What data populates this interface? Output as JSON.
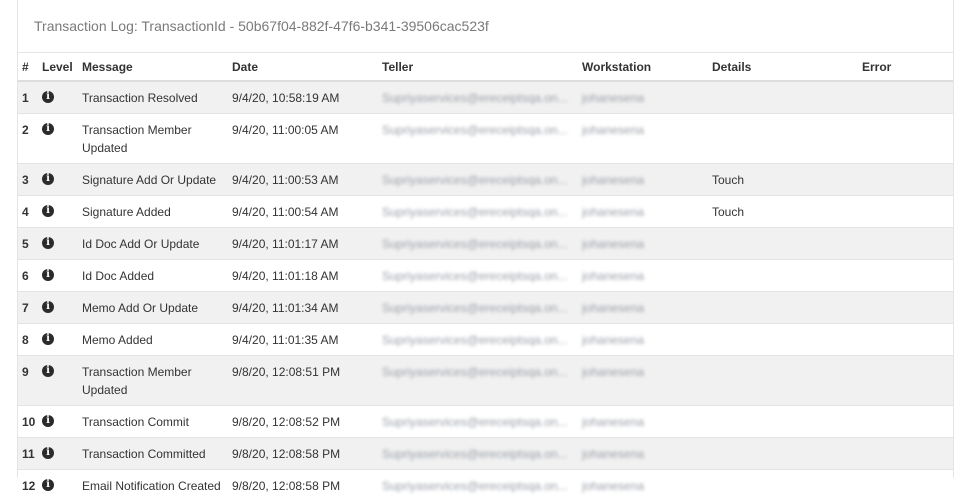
{
  "panel": {
    "title": "Transaction Log: TransactionId - 50b67f04-882f-47f6-b341-39506cac523f"
  },
  "table": {
    "headers": {
      "num": "#",
      "level": "Level",
      "message": "Message",
      "date": "Date",
      "teller": "Teller",
      "workstation": "Workstation",
      "details": "Details",
      "error": "Error"
    },
    "rows": [
      {
        "num": "1",
        "level_icon": "info-icon",
        "message": "Transaction Resolved",
        "date": "9/4/20, 10:58:19 AM",
        "teller": "Supriyaservices@ereceiptsqa.on...",
        "workstation": "johanesena",
        "details": "",
        "error": ""
      },
      {
        "num": "2",
        "level_icon": "info-icon",
        "message": "Transaction Member Updated",
        "date": "9/4/20, 11:00:05 AM",
        "teller": "Supriyaservices@ereceiptsqa.on...",
        "workstation": "johanesena",
        "details": "",
        "error": ""
      },
      {
        "num": "3",
        "level_icon": "info-icon",
        "message": "Signature Add Or Update",
        "date": "9/4/20, 11:00:53 AM",
        "teller": "Supriyaservices@ereceiptsqa.on...",
        "workstation": "johanesena",
        "details": "Touch",
        "error": ""
      },
      {
        "num": "4",
        "level_icon": "info-icon",
        "message": "Signature Added",
        "date": "9/4/20, 11:00:54 AM",
        "teller": "Supriyaservices@ereceiptsqa.on...",
        "workstation": "johanesena",
        "details": "Touch",
        "error": ""
      },
      {
        "num": "5",
        "level_icon": "info-icon",
        "message": "Id Doc Add Or Update",
        "date": "9/4/20, 11:01:17 AM",
        "teller": "Supriyaservices@ereceiptsqa.on...",
        "workstation": "johanesena",
        "details": "",
        "error": ""
      },
      {
        "num": "6",
        "level_icon": "info-icon",
        "message": "Id Doc Added",
        "date": "9/4/20, 11:01:18 AM",
        "teller": "Supriyaservices@ereceiptsqa.on...",
        "workstation": "johanesena",
        "details": "",
        "error": ""
      },
      {
        "num": "7",
        "level_icon": "info-icon",
        "message": "Memo Add Or Update",
        "date": "9/4/20, 11:01:34 AM",
        "teller": "Supriyaservices@ereceiptsqa.on...",
        "workstation": "johanesena",
        "details": "",
        "error": ""
      },
      {
        "num": "8",
        "level_icon": "info-icon",
        "message": "Memo Added",
        "date": "9/4/20, 11:01:35 AM",
        "teller": "Supriyaservices@ereceiptsqa.on...",
        "workstation": "johanesena",
        "details": "",
        "error": ""
      },
      {
        "num": "9",
        "level_icon": "info-icon",
        "message": "Transaction Member Updated",
        "date": "9/8/20, 12:08:51 PM",
        "teller": "Supriyaservices@ereceiptsqa.on...",
        "workstation": "johanesena",
        "details": "",
        "error": ""
      },
      {
        "num": "10",
        "level_icon": "info-icon",
        "message": "Transaction Commit",
        "date": "9/8/20, 12:08:52 PM",
        "teller": "Supriyaservices@ereceiptsqa.on...",
        "workstation": "johanesena",
        "details": "",
        "error": ""
      },
      {
        "num": "11",
        "level_icon": "info-icon",
        "message": "Transaction Committed",
        "date": "9/8/20, 12:08:58 PM",
        "teller": "Supriyaservices@ereceiptsqa.on...",
        "workstation": "johanesena",
        "details": "",
        "error": ""
      },
      {
        "num": "12",
        "level_icon": "info-icon",
        "message": "Email Notification Created",
        "date": "9/8/20, 12:08:58 PM",
        "teller": "Supriyaservices@ereceiptsqa.on...",
        "workstation": "johanesena",
        "details": "",
        "error": ""
      }
    ]
  },
  "colors": {
    "stripe": "#f1f1f1",
    "text": "#333333",
    "title": "#7a7a7a",
    "border": "#e5e5e5"
  }
}
